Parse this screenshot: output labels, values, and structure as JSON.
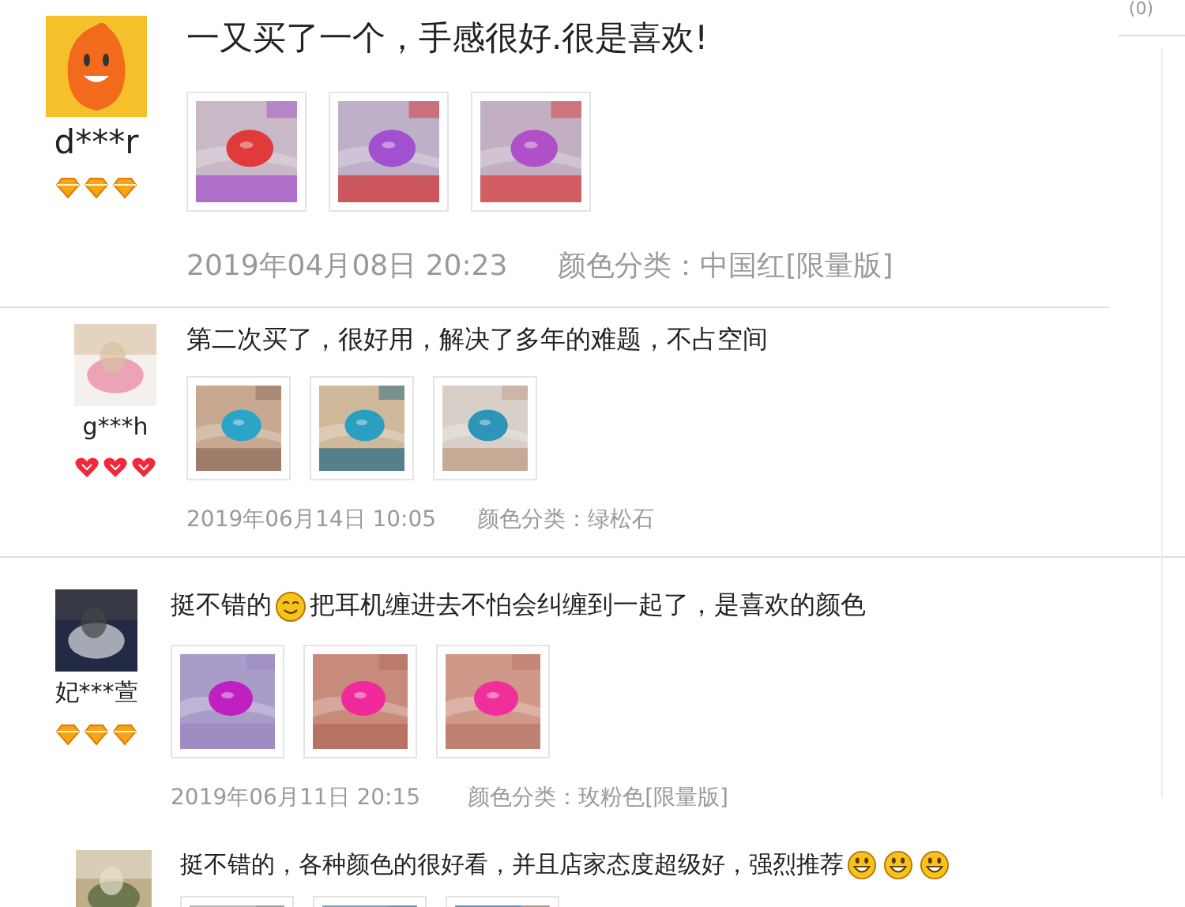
{
  "corner_count": "(0)",
  "reviews": [
    {
      "user": "d***r",
      "badges": [
        {
          "kind": "diamond"
        },
        {
          "kind": "diamond"
        },
        {
          "kind": "diamond"
        }
      ],
      "comment": [
        {
          "kind": "text",
          "text": "一又买了一个，手感很好.很是喜欢!"
        }
      ],
      "photos": [
        {
          "kind": "picture"
        },
        {
          "kind": "picture"
        },
        {
          "kind": "picture"
        }
      ],
      "date": "2019年04月08日 20:23",
      "variant": "颜色分类：中国红[限量版]"
    },
    {
      "user": "g***h",
      "badges": [
        {
          "kind": "heart"
        },
        {
          "kind": "heart"
        },
        {
          "kind": "heart"
        }
      ],
      "comment": [
        {
          "kind": "text",
          "text": "第二次买了，很好用，解决了多年的难题，不占空间"
        }
      ],
      "photos": [
        {
          "kind": "picture"
        },
        {
          "kind": "picture"
        },
        {
          "kind": "picture"
        }
      ],
      "date": "2019年06月14日 10:05",
      "variant": "颜色分类：绿松石"
    },
    {
      "user": "妃***萱",
      "badges": [
        {
          "kind": "diamond"
        },
        {
          "kind": "diamond"
        },
        {
          "kind": "diamond"
        }
      ],
      "comment": [
        {
          "kind": "text",
          "text": "挺不错的"
        },
        {
          "kind": "blush"
        },
        {
          "kind": "text",
          "text": "把耳机缠进去不怕会纠缠到一起了，是喜欢的颜色"
        }
      ],
      "photos": [
        {
          "kind": "picture"
        },
        {
          "kind": "picture"
        },
        {
          "kind": "picture"
        }
      ],
      "date": "2019年06月11日 20:15",
      "variant": "颜色分类：玫粉色[限量版]"
    },
    {
      "comment": [
        {
          "kind": "text",
          "text": "挺不错的，各种颜色的很好看，并且店家态度超级好，强烈推荐"
        },
        {
          "kind": "grin"
        },
        {
          "kind": "grin"
        },
        {
          "kind": "grin"
        }
      ],
      "photos": [
        {
          "kind": "picture"
        },
        {
          "kind": "picture"
        },
        {
          "kind": "picture"
        }
      ]
    }
  ]
}
